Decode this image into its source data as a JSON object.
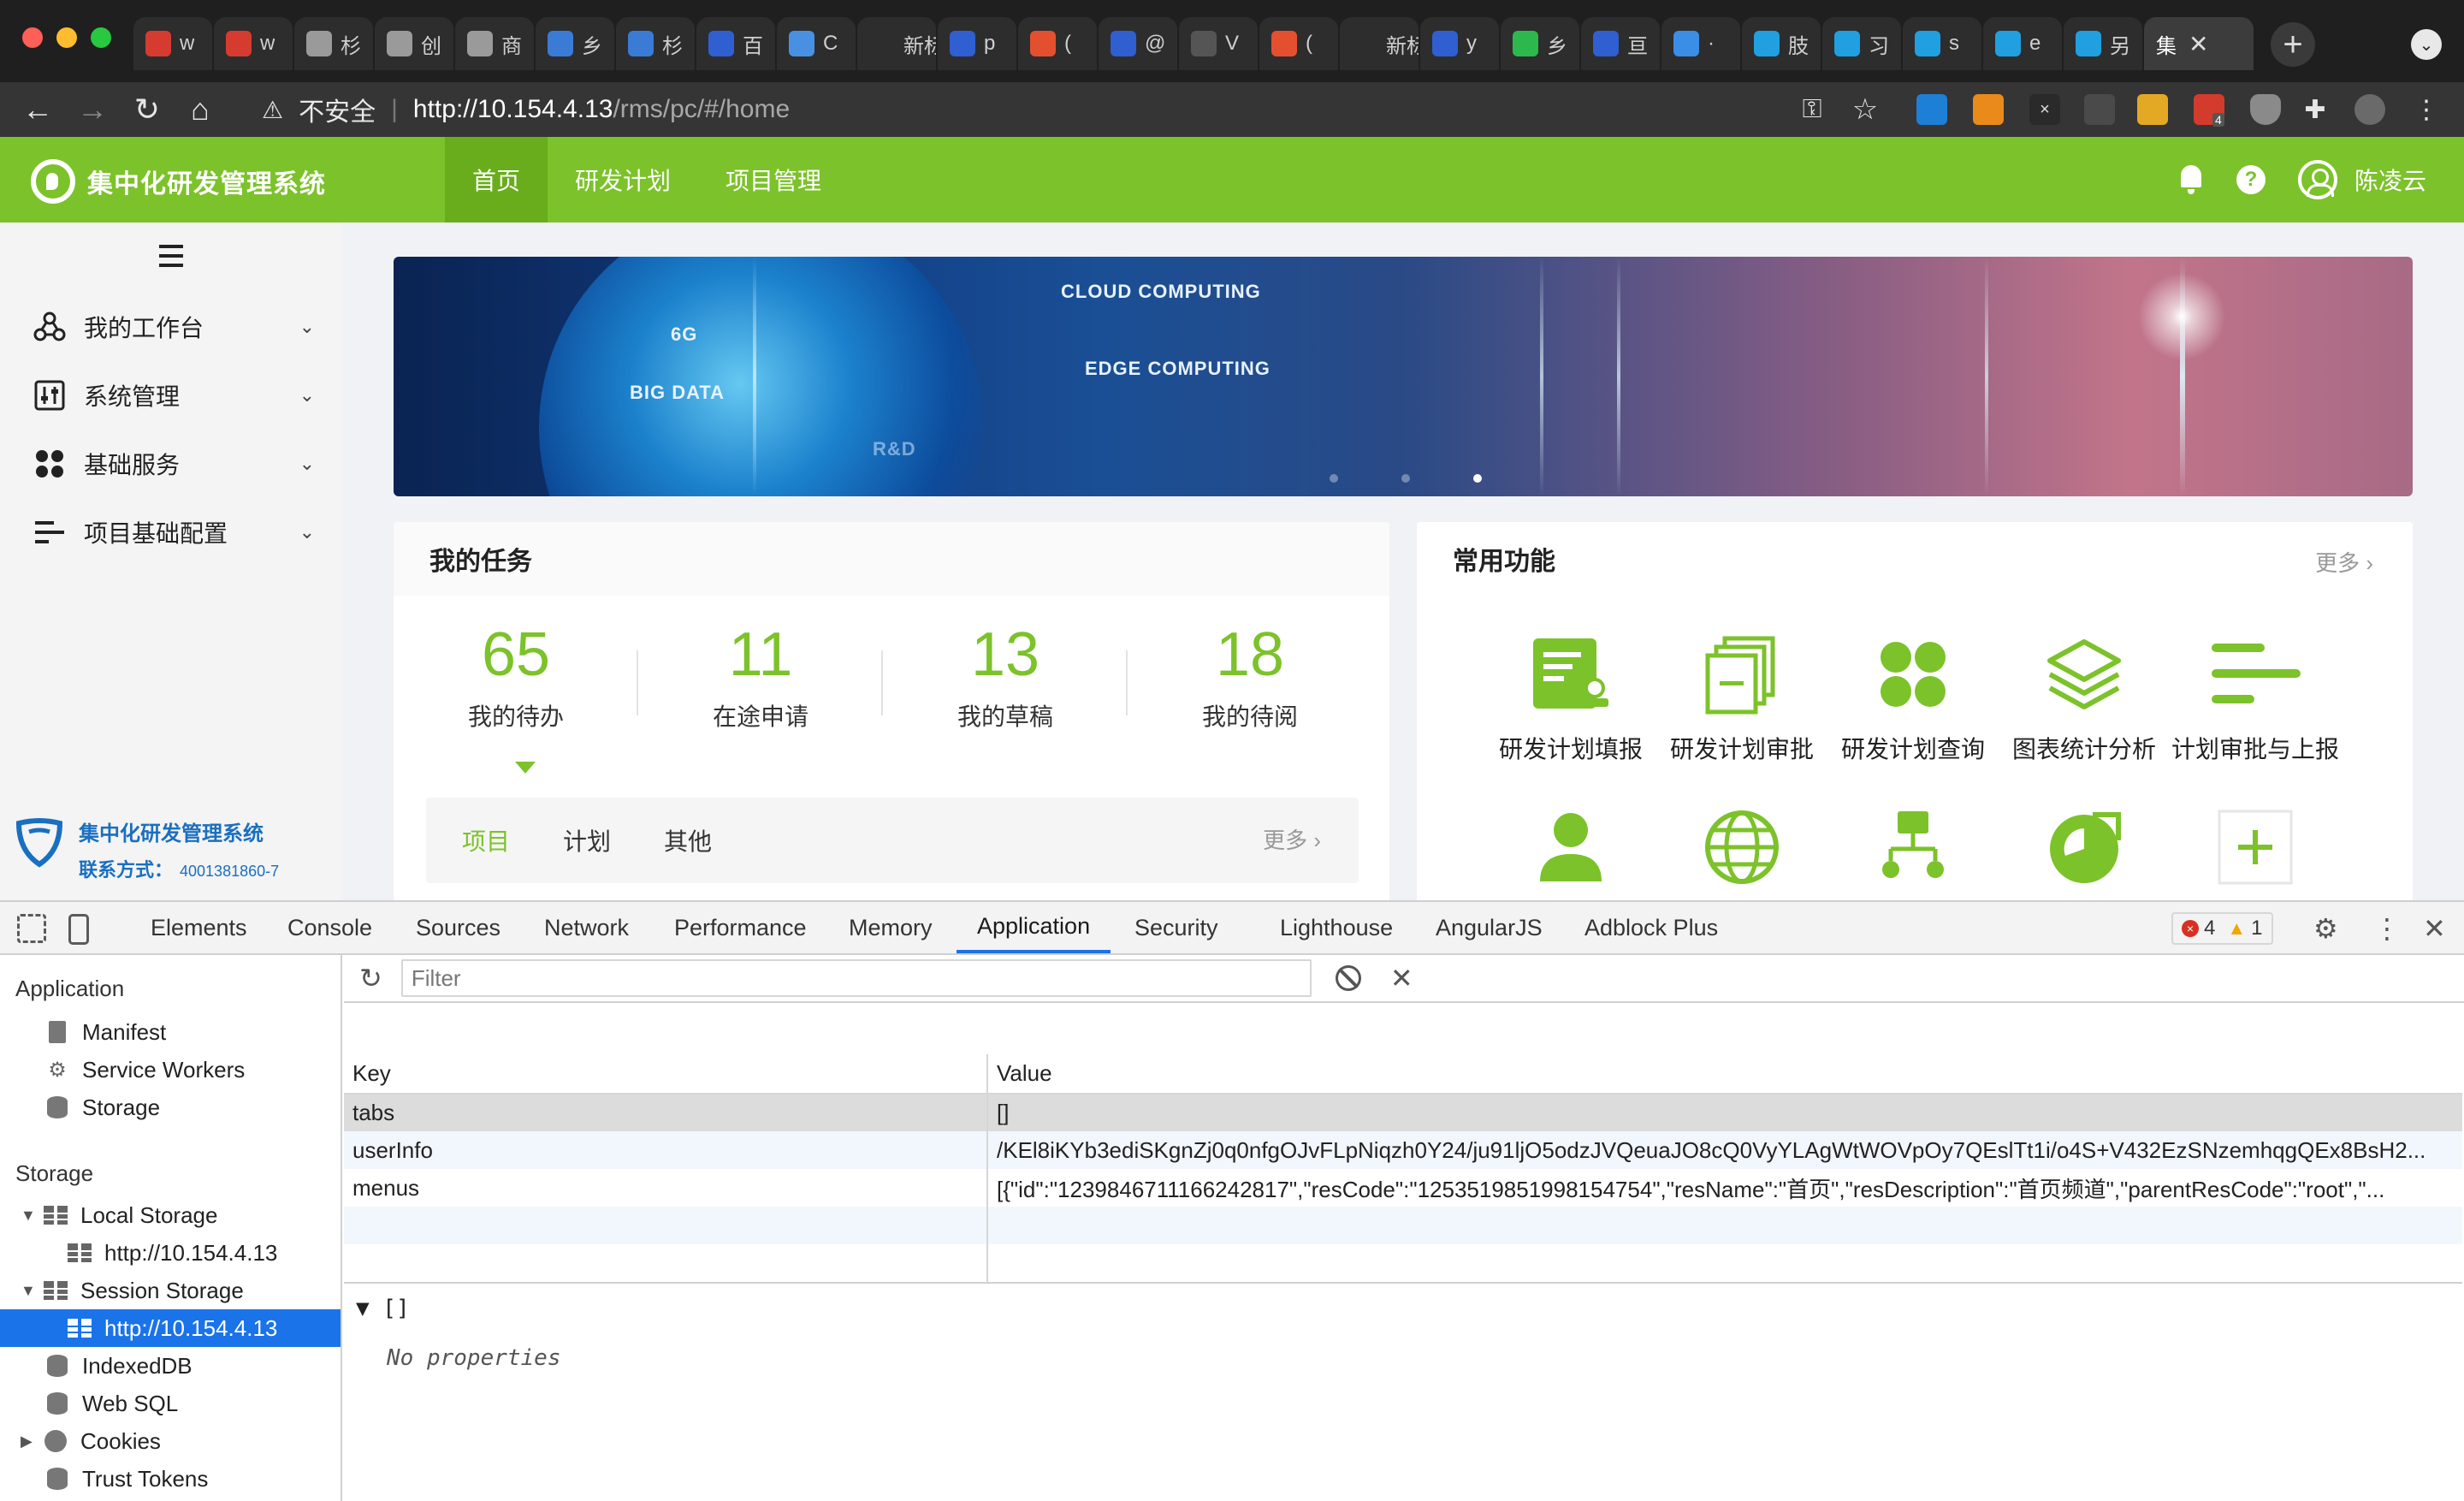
{
  "browser": {
    "tabs": [
      {
        "label": "w",
        "color": "#d63b2f"
      },
      {
        "label": "w",
        "color": "#d63b2f"
      },
      {
        "label": "杉",
        "color": "#9a9a9a"
      },
      {
        "label": "创",
        "color": "#9a9a9a"
      },
      {
        "label": "商",
        "color": "#9a9a9a"
      },
      {
        "label": "乡",
        "color": "#3a7bd5"
      },
      {
        "label": "杉",
        "color": "#3a7bd5"
      },
      {
        "label": "百",
        "color": "#2f5fd0"
      },
      {
        "label": "C",
        "color": "#4a90e2"
      },
      {
        "label": "新标签",
        "color": "#2d2d2d"
      },
      {
        "label": "p",
        "color": "#2f5fd0"
      },
      {
        "label": "(",
        "color": "#e4502f"
      },
      {
        "label": "@",
        "color": "#2f5fd0"
      },
      {
        "label": "V",
        "color": "#555555"
      },
      {
        "label": "(",
        "color": "#e4502f"
      },
      {
        "label": "新标签",
        "color": "#2d2d2d"
      },
      {
        "label": "y",
        "color": "#2f5fd0"
      },
      {
        "label": "乡",
        "color": "#2db84d"
      },
      {
        "label": "亘",
        "color": "#2f5fd0"
      },
      {
        "label": "·",
        "color": "#3a8ee6"
      },
      {
        "label": "肢",
        "color": "#20a0e0"
      },
      {
        "label": "习",
        "color": "#20a0e0"
      },
      {
        "label": "s",
        "color": "#20a0e0"
      },
      {
        "label": "e",
        "color": "#20a0e0"
      },
      {
        "label": "另",
        "color": "#20a0e0"
      }
    ],
    "active_tab": {
      "label": "集"
    },
    "new_tab_symbol": "+",
    "insecure_label": "不安全",
    "url_host": "http://10.154.4.13",
    "url_path": "/rms/pc/#/home",
    "extension_badge": "4"
  },
  "app": {
    "name": "集中化研发管理系统",
    "nav": [
      {
        "label": "首页",
        "active": true
      },
      {
        "label": "研发计划",
        "active": false
      },
      {
        "label": "项目管理",
        "active": false
      }
    ],
    "user": "陈凌云",
    "help_symbol": "?"
  },
  "sidebar": {
    "items": [
      {
        "label": "我的工作台",
        "icon": "workbench-icon"
      },
      {
        "label": "系统管理",
        "icon": "system-icon"
      },
      {
        "label": "基础服务",
        "icon": "services-icon"
      },
      {
        "label": "项目基础配置",
        "icon": "config-icon"
      }
    ],
    "footer_title": "集中化研发管理系统",
    "footer_contact_label": "联系方式：",
    "footer_phone": "4001381860-7"
  },
  "banner": {
    "texts": [
      "CLOUD COMPUTING",
      "6G",
      "EDGE COMPUTING",
      "BIG DATA",
      "R&D"
    ],
    "active_slide": 3
  },
  "tasks": {
    "title": "我的任务",
    "stats": [
      {
        "value": "65",
        "label": "我的待办"
      },
      {
        "value": "11",
        "label": "在途申请"
      },
      {
        "value": "13",
        "label": "我的草稿"
      },
      {
        "value": "18",
        "label": "我的待阅"
      }
    ],
    "subtabs": [
      {
        "label": "项目",
        "active": true
      },
      {
        "label": "计划",
        "active": false
      },
      {
        "label": "其他",
        "active": false
      }
    ],
    "more_label": "更多 ›"
  },
  "functions": {
    "title": "常用功能",
    "more_label": "更多 ›",
    "items": [
      {
        "label": "研发计划填报",
        "icon": "plan-fill-icon"
      },
      {
        "label": "研发计划审批",
        "icon": "plan-approve-icon"
      },
      {
        "label": "研发计划查询",
        "icon": "plan-query-icon"
      },
      {
        "label": "图表统计分析",
        "icon": "chart-analysis-icon"
      },
      {
        "label": "计划审批与上报",
        "icon": "approve-report-icon"
      },
      {
        "label": "",
        "icon": "person-icon"
      },
      {
        "label": "",
        "icon": "globe-icon"
      },
      {
        "label": "",
        "icon": "org-tree-icon"
      },
      {
        "label": "",
        "icon": "pie-icon"
      },
      {
        "label": "",
        "icon": "add-icon"
      }
    ]
  },
  "devtools": {
    "tabs": [
      "Elements",
      "Console",
      "Sources",
      "Network",
      "Performance",
      "Memory",
      "Application",
      "Security",
      "Lighthouse",
      "AngularJS",
      "Adblock Plus"
    ],
    "active_tab": "Application",
    "errors": "4",
    "warnings": "1",
    "sidebar": {
      "application_title": "Application",
      "application_items": [
        "Manifest",
        "Service Workers",
        "Storage"
      ],
      "storage_title": "Storage",
      "local_storage": "Local Storage",
      "local_origin": "http://10.154.4.13",
      "session_storage": "Session Storage",
      "session_origin": "http://10.154.4.13",
      "indexeddb": "IndexedDB",
      "websql": "Web SQL",
      "cookies": "Cookies",
      "trust_tokens": "Trust Tokens"
    },
    "filter_placeholder": "Filter",
    "table": {
      "headers": [
        "Key",
        "Value"
      ],
      "rows": [
        {
          "key": "tabs",
          "value": "[]"
        },
        {
          "key": "userInfo",
          "value": "/KEl8iKYb3ediSKgnZj0q0nfgOJvFLpNiqzh0Y24/ju91ljO5odzJVQeuaJO8cQ0VyYLAgWtWOVpOy7QEslTt1i/o4S+V432EzSNzemhqgQEx8BsH2..."
        },
        {
          "key": "menus",
          "value": "[{\"id\":\"1239846711166242817\",\"resCode\":\"1253519851998154754\",\"resName\":\"首页\",\"resDescription\":\"首页频道\",\"parentResCode\":\"root\",\"..."
        }
      ]
    },
    "preview_label": "▼ []",
    "no_properties": "No properties"
  }
}
